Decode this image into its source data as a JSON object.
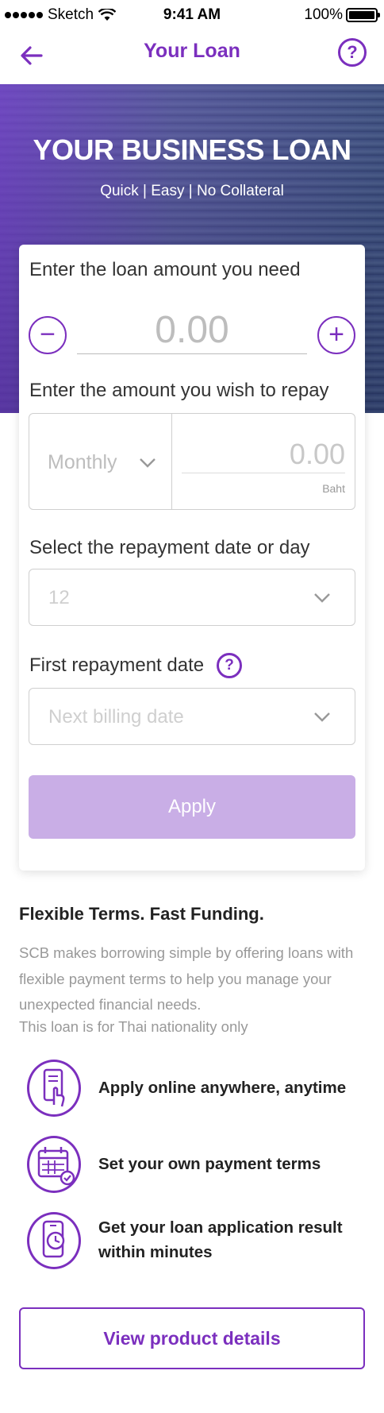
{
  "status_bar": {
    "carrier": "Sketch",
    "time": "9:41 AM",
    "battery": "100%"
  },
  "nav": {
    "title": "Your Loan",
    "help_symbol": "?"
  },
  "hero": {
    "title": "YOUR BUSINESS LOAN",
    "subtitle": "Quick | Easy | No Collateral"
  },
  "form": {
    "loan_amount_label": "Enter the loan amount you need",
    "loan_amount_placeholder": "0.00",
    "decrement_symbol": "−",
    "increment_symbol": "+",
    "repay_label": "Enter the amount you wish to repay",
    "repay_frequency": "Monthly",
    "repay_amount_placeholder": "0.00",
    "repay_unit": "Baht",
    "repay_date_label": "Select the repayment date or day",
    "repay_date_value": "12",
    "first_date_label": "First repayment date",
    "first_date_help": "?",
    "first_date_placeholder": "Next billing date",
    "apply_label": "Apply"
  },
  "info": {
    "title": "Flexible Terms. Fast Funding.",
    "description": "SCB makes borrowing simple by offering loans with flexible payment terms to help you manage your unexpected financial needs.",
    "note": "This loan is for Thai nationality only"
  },
  "features": [
    {
      "icon": "mobile-tap-icon",
      "text": "Apply online anywhere, anytime"
    },
    {
      "icon": "calendar-check-icon",
      "text": "Set your own payment terms"
    },
    {
      "icon": "phone-clock-icon",
      "text": "Get your loan application result within minutes"
    }
  ],
  "cta": {
    "view_details_label": "View product details"
  },
  "colors": {
    "brand_purple": "#7b2fbe",
    "apply_disabled": "#c9aee6"
  }
}
